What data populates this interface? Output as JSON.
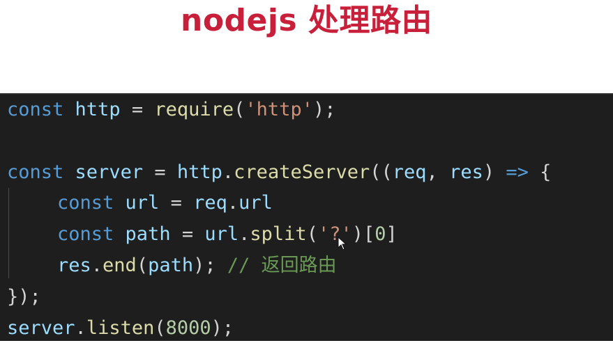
{
  "title": "nodejs 处理路由",
  "code": {
    "line1": [
      "const",
      " ",
      "http",
      " = ",
      "require",
      "(",
      "'http'",
      ");"
    ],
    "line3": [
      "const",
      " ",
      "server",
      " = ",
      "http",
      ".",
      "createServer",
      "((",
      "req",
      ", ",
      "res",
      ") ",
      "=>",
      " {"
    ],
    "line4": [
      "const",
      " ",
      "url",
      " = ",
      "req",
      ".",
      "url"
    ],
    "line5": [
      "const",
      " ",
      "path",
      " = ",
      "url",
      ".",
      "split",
      "(",
      "'?'",
      ")[",
      "0",
      "]"
    ],
    "line6": [
      "res",
      ".",
      "end",
      "(",
      "path",
      "); ",
      "// 返回路由"
    ],
    "line7": [
      "});"
    ],
    "line8": [
      "server",
      ".",
      "listen",
      "(",
      "8000",
      ");"
    ]
  },
  "cursor_icon": "mouse-pointer-icon"
}
